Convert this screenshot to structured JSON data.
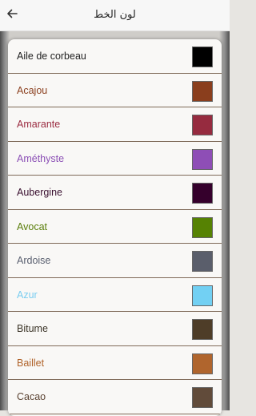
{
  "header": {
    "title": "لون الخط",
    "back_icon": "arrow-left-icon"
  },
  "colors": [
    {
      "name": "Aile de corbeau",
      "text_color": "#222222",
      "swatch": "#000000"
    },
    {
      "name": "Acajou",
      "text_color": "#8b3f1e",
      "swatch": "#8a3e1d"
    },
    {
      "name": "Amarante",
      "text_color": "#9b2c41",
      "swatch": "#962b3f"
    },
    {
      "name": "Améthyste",
      "text_color": "#8b4fb5",
      "swatch": "#8e4eb6"
    },
    {
      "name": "Aubergine",
      "text_color": "#3a1030",
      "swatch": "#35002c"
    },
    {
      "name": "Avocat",
      "text_color": "#5a7e0a",
      "swatch": "#568203"
    },
    {
      "name": "Ardoise",
      "text_color": "#5a6070",
      "swatch": "#5a5e6b"
    },
    {
      "name": "Azur",
      "text_color": "#7acdf0",
      "swatch": "#72d0f3"
    },
    {
      "name": "Bitume",
      "text_color": "#3c3528",
      "swatch": "#4e3d28"
    },
    {
      "name": "Baillet",
      "text_color": "#b0632a",
      "swatch": "#b0652d"
    },
    {
      "name": "Cacao",
      "text_color": "#5b4332",
      "swatch": "#614b3a"
    }
  ]
}
